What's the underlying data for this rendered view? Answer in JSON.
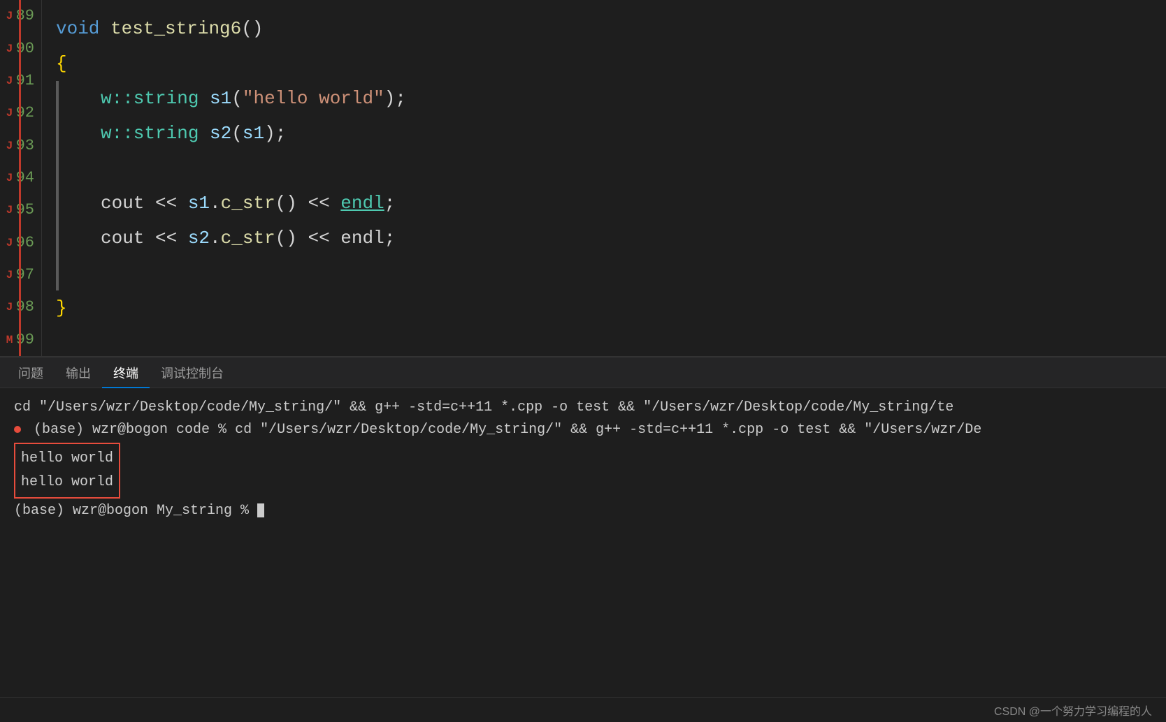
{
  "editor": {
    "lines": [
      {
        "number": "89",
        "content_type": "ellipsis"
      },
      {
        "number": "90",
        "content_type": "function_decl",
        "text": "void test_string6()"
      },
      {
        "number": "91",
        "content_type": "open_brace",
        "text": "{"
      },
      {
        "number": "92",
        "content_type": "code",
        "text": "        w::string s1(\"hello world\");"
      },
      {
        "number": "93",
        "content_type": "code",
        "text": "        w::string s2(s1);"
      },
      {
        "number": "94",
        "content_type": "empty"
      },
      {
        "number": "95",
        "content_type": "code",
        "text": "        cout << s1.c_str() << endl;"
      },
      {
        "number": "96",
        "content_type": "code",
        "text": "        cout << s2.c_str() << endl;"
      },
      {
        "number": "97",
        "content_type": "empty"
      },
      {
        "number": "98",
        "content_type": "close_brace",
        "text": "}"
      },
      {
        "number": "99",
        "content_type": "ellipsis"
      }
    ]
  },
  "tabs": {
    "items": [
      {
        "label": "问题",
        "active": false
      },
      {
        "label": "输出",
        "active": false
      },
      {
        "label": "终端",
        "active": true
      },
      {
        "label": "调试控制台",
        "active": false
      }
    ]
  },
  "terminal": {
    "command_line1": "cd \"/Users/wzr/Desktop/code/My_string/\" && g++ -std=c++11 *.cpp -o test && \"/Users/wzr/Desktop/code/My_string/te",
    "command_line2": "(base) wzr@bogon code % cd \"/Users/wzr/Desktop/code/My_string/\" && g++ -std=c++11 *.cpp -o test && \"/Users/wzr/De",
    "output1": "hello world",
    "output2": "hello world",
    "prompt_line": "(base) wzr@bogon My_string % "
  },
  "footer": {
    "text": "CSDN @一个努力学习编程的人"
  },
  "colors": {
    "keyword": "#569cd6",
    "function": "#dcdcaa",
    "type": "#4ec9b0",
    "string": "#ce9178",
    "variable": "#9cdcfe",
    "plain": "#d4d4d4",
    "brace": "#ffd700",
    "line_number": "#6a9955",
    "endl_color": "#4ec9b0",
    "highlight_border": "#e74c3c",
    "active_tab": "#0078d4",
    "bg": "#1e1e1e"
  }
}
